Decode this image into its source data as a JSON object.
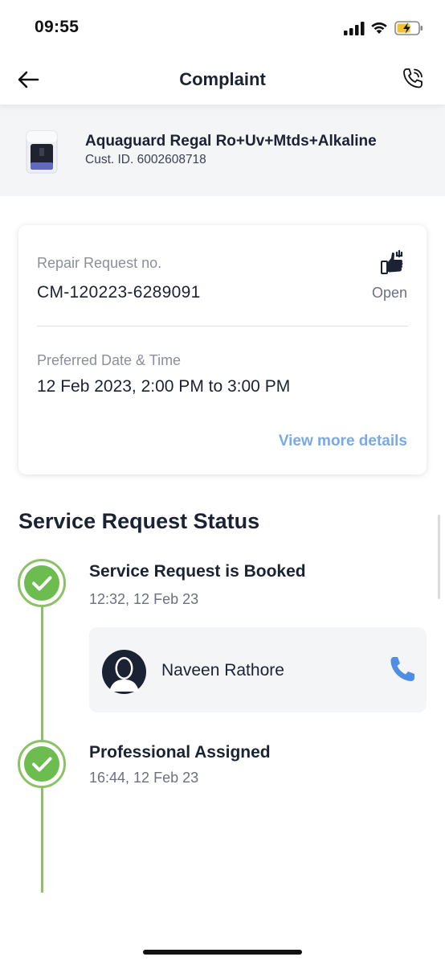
{
  "status_bar": {
    "time": "09:55"
  },
  "header": {
    "title": "Complaint",
    "back_icon": "arrow-left-icon",
    "call_icon": "phone-call-icon"
  },
  "product": {
    "name": "Aquaguard Regal Ro+Uv+Mtds+Alkaline",
    "customer_id": "Cust. ID. 6002608718"
  },
  "request_card": {
    "repair_label": "Repair Request no.",
    "repair_number": "CM-120223-6289091",
    "status": "Open",
    "status_icon": "repair-thumbs-up-icon",
    "preferred_label": "Preferred Date & Time",
    "preferred_value": "12 Feb 2023, 2:00 PM to 3:00 PM",
    "view_more": "View more details"
  },
  "service_status": {
    "title": "Service Request Status",
    "steps": [
      {
        "title": "Service Request is Booked",
        "time": "12:32, 12 Feb 23",
        "completed": true
      },
      {
        "title": "Professional Assigned",
        "time": "16:44, 12 Feb 23",
        "completed": true
      }
    ],
    "professional": {
      "name": "Naveen Rathore"
    }
  },
  "colors": {
    "accent_link": "#7aa9e3",
    "success_green": "#6cbc4f",
    "timeline_green": "#8cc266",
    "call_blue": "#4f8fe3",
    "text_dark": "#1b2233"
  }
}
